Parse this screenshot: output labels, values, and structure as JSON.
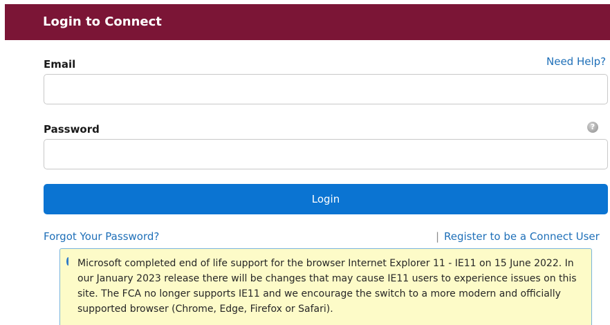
{
  "header": {
    "title": "Login to Connect"
  },
  "form": {
    "email_label": "Email",
    "need_help": "Need Help?",
    "email_value": "",
    "password_label": "Password",
    "password_value": "",
    "help_icon": "?",
    "login_label": "Login"
  },
  "links": {
    "forgot_password": "Forgot Your Password?",
    "separator": "|",
    "register": "Register to be a Connect User"
  },
  "notice": {
    "icon": "info-icon",
    "text": "Microsoft completed end of life support for the browser Internet Explorer 11 - IE11 on 15 June 2022. In our January 2023 release there will be changes that may cause IE11 users to experience issues on this site. The FCA no longer supports IE11 and we encourage the switch to a more modern and officially supported browser (Chrome, Edge, Firefox or Safari)."
  },
  "colors": {
    "header_bg": "#7b1536",
    "button_bg": "#0b74d2",
    "link": "#1e6fb8",
    "notice_bg": "#fdfbc8",
    "notice_border": "#78b4dc"
  }
}
